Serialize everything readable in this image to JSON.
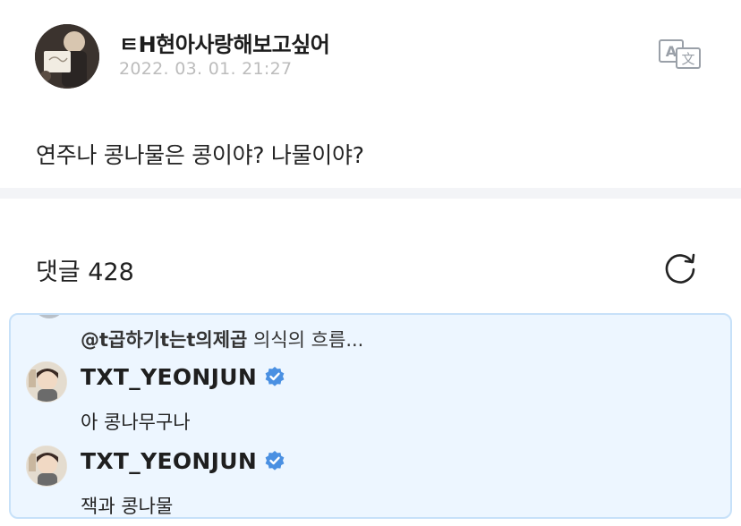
{
  "post": {
    "author": "ㅌH현아사랑해보고싶어",
    "timestamp": "2022. 03. 01. 21:27",
    "body": "연주나 콩나물은 콩이야? 나물이야?",
    "avatar_icon": "user-photo-avatar",
    "translate_icon": "translate-icon"
  },
  "comments": {
    "title": "댓글 428",
    "refresh_icon": "refresh-icon",
    "reply_to": {
      "mention": "@t곱하기t는t의제곱",
      "text": "의식의 흐름..."
    },
    "items": [
      {
        "author": "TXT_YEONJUN",
        "verified": true,
        "text": "아 콩나무구나"
      },
      {
        "author": "TXT_YEONJUN",
        "verified": true,
        "text": "잭과 콩나물"
      }
    ]
  },
  "colors": {
    "verified_badge": "#4a90e2",
    "comment_box_bg": "#edf6ff",
    "comment_box_border": "#c7e1f9",
    "timestamp": "#bcbcbc",
    "divider": "#f3f4f7"
  }
}
